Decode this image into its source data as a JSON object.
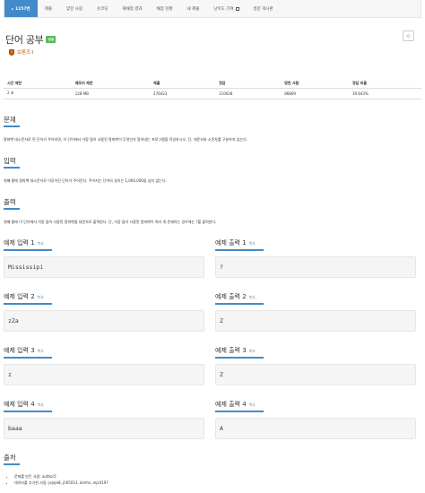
{
  "nav": {
    "items": [
      {
        "label": "1157번",
        "active": true
      },
      {
        "label": "제출"
      },
      {
        "label": "맞힌 사람"
      },
      {
        "label": "숏코딩"
      },
      {
        "label": "재채점 결과"
      },
      {
        "label": "채점 현황"
      },
      {
        "label": "내 제출"
      },
      {
        "label": "난이도 기여"
      },
      {
        "label": "질문 게시판"
      }
    ]
  },
  "problem": {
    "title": "단어 공부",
    "lang_badge": "성공",
    "tier": "브론즈 I",
    "tier_color": "#ad5600",
    "star_icon": "star-icon"
  },
  "info": {
    "headers": [
      "시간 제한",
      "메모리 제한",
      "제출",
      "정답",
      "맞힌 사람",
      "정답 비율"
    ],
    "values": [
      "2 초",
      "128 MB",
      "276423",
      "110028",
      "86869",
      "39.643%"
    ]
  },
  "sections": {
    "problem": {
      "title": "문제",
      "text": "알파벳 대소문자로 된 단어가 주어지면, 이 단어에서 가장 많이 사용된 알파벳이 무엇인지 알아내는 프로그램을 작성하시오. 단, 대문자와 소문자를 구분하지 않는다."
    },
    "input": {
      "title": "입력",
      "text": "첫째 줄에 알파벳 대소문자로 이루어진 단어가 주어진다. 주어지는 단어의 길이는 1,000,000을 넘지 않는다."
    },
    "output": {
      "title": "출력",
      "text": "첫째 줄에 이 단어에서 가장 많이 사용된 알파벳을 대문자로 출력한다. 단, 가장 많이 사용된 알파벳이 여러 개 존재하는 경우에는 ?를 출력한다."
    },
    "source": {
      "title": "출처",
      "items": [
        "문제를 만든 사람: author5",
        "데이터를 추가한 사람: jejeje8, jh05013, kimhs, mjs4197"
      ]
    }
  },
  "examples": {
    "copy_label": "복사",
    "list": [
      {
        "in_title": "예제 입력 1",
        "in_value": "Mississipi",
        "out_title": "예제 출력 1",
        "out_value": "?"
      },
      {
        "in_title": "예제 입력 2",
        "in_value": "zZa",
        "out_title": "예제 출력 2",
        "out_value": "Z"
      },
      {
        "in_title": "예제 입력 3",
        "in_value": "z",
        "out_title": "예제 출력 3",
        "out_value": "Z"
      },
      {
        "in_title": "예제 입력 4",
        "in_value": "baaa",
        "out_title": "예제 출력 4",
        "out_value": "A"
      }
    ]
  },
  "colors": {
    "accent": "#428bca",
    "success": "#5cb85c"
  }
}
